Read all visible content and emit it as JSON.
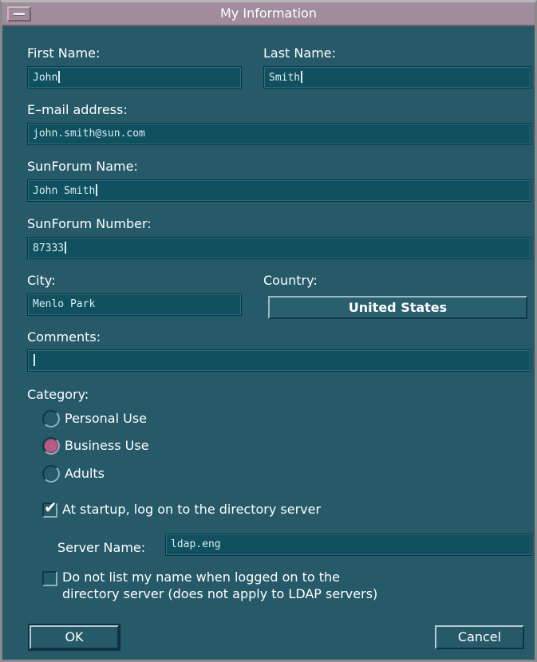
{
  "window": {
    "title": "My Information"
  },
  "fields": {
    "first_name": {
      "label": "First Name:",
      "value": "John"
    },
    "last_name": {
      "label": "Last Name:",
      "value": "Smith"
    },
    "email": {
      "label": "E–mail address:",
      "value": "john.smith@sun.com"
    },
    "sunforum_name": {
      "label": "SunForum Name:",
      "value": "John Smith"
    },
    "sunforum_number": {
      "label": "SunForum Number:",
      "value": "87333"
    },
    "city": {
      "label": "City:",
      "value": "Menlo Park"
    },
    "country": {
      "label": "Country:",
      "value": "United States"
    },
    "comments": {
      "label": "Comments:",
      "value": ""
    }
  },
  "category": {
    "label": "Category:",
    "options": [
      {
        "label": "Personal Use",
        "selected": false
      },
      {
        "label": "Business Use",
        "selected": true
      },
      {
        "label": "Adults",
        "selected": false
      }
    ]
  },
  "startup_logon": {
    "label": "At startup, log on to the directory server",
    "checked": true
  },
  "server": {
    "label": "Server Name:",
    "value": "ldap.eng"
  },
  "do_not_list": {
    "label_line1": "Do not list my name when logged on to the",
    "label_line2": "directory server (does not apply to LDAP servers)",
    "checked": false
  },
  "buttons": {
    "ok": "OK",
    "cancel": "Cancel"
  },
  "colors": {
    "background": "#265a69",
    "field": "#11505f",
    "titlebar": "#a08c9a",
    "radio_selected": "#b25c86"
  }
}
